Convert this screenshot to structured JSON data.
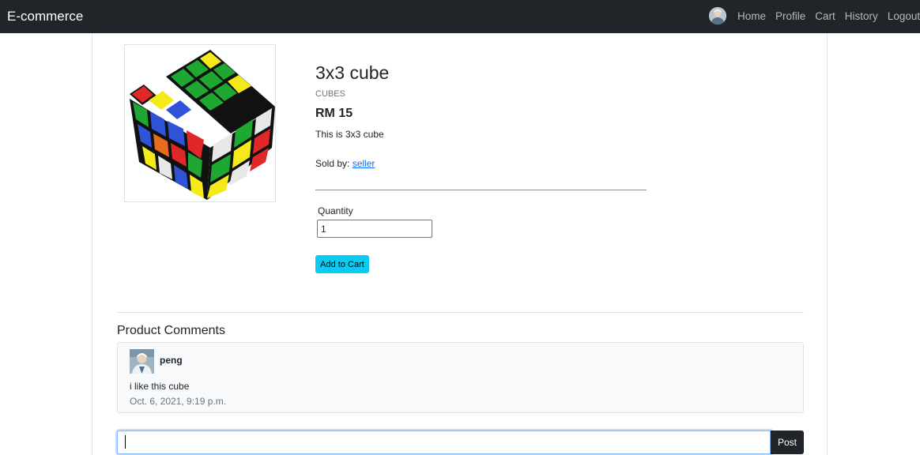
{
  "navbar": {
    "brand": "E-commerce",
    "links": [
      "Home",
      "Profile",
      "Cart",
      "History",
      "Logout"
    ]
  },
  "product": {
    "title": "3x3 cube",
    "category": "CUBES",
    "price": "RM 15",
    "description": "This is 3x3 cube",
    "sold_by_label": "Sold by:",
    "seller": "seller",
    "quantity_label": "Quantity",
    "quantity_value": "1",
    "add_to_cart_label": "Add to Cart"
  },
  "comments": {
    "heading": "Product Comments",
    "items": [
      {
        "user": "peng",
        "text": "i like this cube",
        "date": "Oct. 6, 2021, 9:19 p.m."
      }
    ],
    "input_value": "",
    "post_label": "Post"
  },
  "colors": {
    "navbar_bg": "#212529",
    "button_info": "#0dcaf0",
    "link": "#0d6efd"
  }
}
